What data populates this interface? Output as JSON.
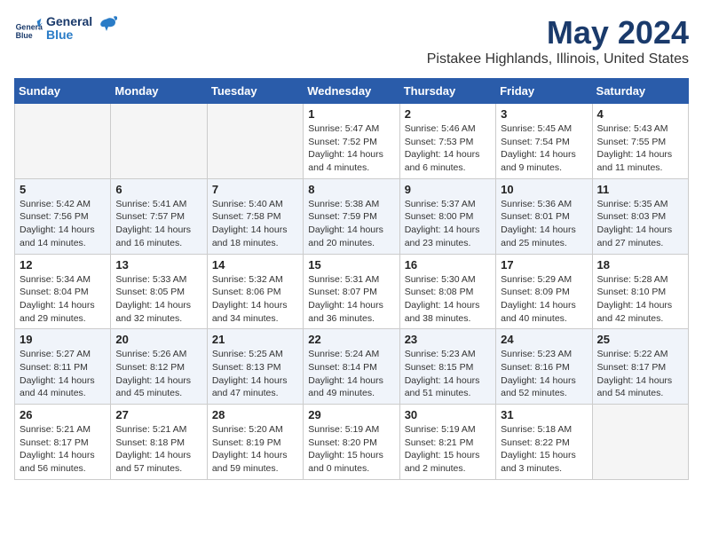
{
  "logo": {
    "line1": "General",
    "line2": "Blue"
  },
  "title": "May 2024",
  "location": "Pistakee Highlands, Illinois, United States",
  "days_of_week": [
    "Sunday",
    "Monday",
    "Tuesday",
    "Wednesday",
    "Thursday",
    "Friday",
    "Saturday"
  ],
  "weeks": [
    [
      {
        "day": "",
        "info": ""
      },
      {
        "day": "",
        "info": ""
      },
      {
        "day": "",
        "info": ""
      },
      {
        "day": "1",
        "info": "Sunrise: 5:47 AM\nSunset: 7:52 PM\nDaylight: 14 hours\nand 4 minutes."
      },
      {
        "day": "2",
        "info": "Sunrise: 5:46 AM\nSunset: 7:53 PM\nDaylight: 14 hours\nand 6 minutes."
      },
      {
        "day": "3",
        "info": "Sunrise: 5:45 AM\nSunset: 7:54 PM\nDaylight: 14 hours\nand 9 minutes."
      },
      {
        "day": "4",
        "info": "Sunrise: 5:43 AM\nSunset: 7:55 PM\nDaylight: 14 hours\nand 11 minutes."
      }
    ],
    [
      {
        "day": "5",
        "info": "Sunrise: 5:42 AM\nSunset: 7:56 PM\nDaylight: 14 hours\nand 14 minutes."
      },
      {
        "day": "6",
        "info": "Sunrise: 5:41 AM\nSunset: 7:57 PM\nDaylight: 14 hours\nand 16 minutes."
      },
      {
        "day": "7",
        "info": "Sunrise: 5:40 AM\nSunset: 7:58 PM\nDaylight: 14 hours\nand 18 minutes."
      },
      {
        "day": "8",
        "info": "Sunrise: 5:38 AM\nSunset: 7:59 PM\nDaylight: 14 hours\nand 20 minutes."
      },
      {
        "day": "9",
        "info": "Sunrise: 5:37 AM\nSunset: 8:00 PM\nDaylight: 14 hours\nand 23 minutes."
      },
      {
        "day": "10",
        "info": "Sunrise: 5:36 AM\nSunset: 8:01 PM\nDaylight: 14 hours\nand 25 minutes."
      },
      {
        "day": "11",
        "info": "Sunrise: 5:35 AM\nSunset: 8:03 PM\nDaylight: 14 hours\nand 27 minutes."
      }
    ],
    [
      {
        "day": "12",
        "info": "Sunrise: 5:34 AM\nSunset: 8:04 PM\nDaylight: 14 hours\nand 29 minutes."
      },
      {
        "day": "13",
        "info": "Sunrise: 5:33 AM\nSunset: 8:05 PM\nDaylight: 14 hours\nand 32 minutes."
      },
      {
        "day": "14",
        "info": "Sunrise: 5:32 AM\nSunset: 8:06 PM\nDaylight: 14 hours\nand 34 minutes."
      },
      {
        "day": "15",
        "info": "Sunrise: 5:31 AM\nSunset: 8:07 PM\nDaylight: 14 hours\nand 36 minutes."
      },
      {
        "day": "16",
        "info": "Sunrise: 5:30 AM\nSunset: 8:08 PM\nDaylight: 14 hours\nand 38 minutes."
      },
      {
        "day": "17",
        "info": "Sunrise: 5:29 AM\nSunset: 8:09 PM\nDaylight: 14 hours\nand 40 minutes."
      },
      {
        "day": "18",
        "info": "Sunrise: 5:28 AM\nSunset: 8:10 PM\nDaylight: 14 hours\nand 42 minutes."
      }
    ],
    [
      {
        "day": "19",
        "info": "Sunrise: 5:27 AM\nSunset: 8:11 PM\nDaylight: 14 hours\nand 44 minutes."
      },
      {
        "day": "20",
        "info": "Sunrise: 5:26 AM\nSunset: 8:12 PM\nDaylight: 14 hours\nand 45 minutes."
      },
      {
        "day": "21",
        "info": "Sunrise: 5:25 AM\nSunset: 8:13 PM\nDaylight: 14 hours\nand 47 minutes."
      },
      {
        "day": "22",
        "info": "Sunrise: 5:24 AM\nSunset: 8:14 PM\nDaylight: 14 hours\nand 49 minutes."
      },
      {
        "day": "23",
        "info": "Sunrise: 5:23 AM\nSunset: 8:15 PM\nDaylight: 14 hours\nand 51 minutes."
      },
      {
        "day": "24",
        "info": "Sunrise: 5:23 AM\nSunset: 8:16 PM\nDaylight: 14 hours\nand 52 minutes."
      },
      {
        "day": "25",
        "info": "Sunrise: 5:22 AM\nSunset: 8:17 PM\nDaylight: 14 hours\nand 54 minutes."
      }
    ],
    [
      {
        "day": "26",
        "info": "Sunrise: 5:21 AM\nSunset: 8:17 PM\nDaylight: 14 hours\nand 56 minutes."
      },
      {
        "day": "27",
        "info": "Sunrise: 5:21 AM\nSunset: 8:18 PM\nDaylight: 14 hours\nand 57 minutes."
      },
      {
        "day": "28",
        "info": "Sunrise: 5:20 AM\nSunset: 8:19 PM\nDaylight: 14 hours\nand 59 minutes."
      },
      {
        "day": "29",
        "info": "Sunrise: 5:19 AM\nSunset: 8:20 PM\nDaylight: 15 hours\nand 0 minutes."
      },
      {
        "day": "30",
        "info": "Sunrise: 5:19 AM\nSunset: 8:21 PM\nDaylight: 15 hours\nand 2 minutes."
      },
      {
        "day": "31",
        "info": "Sunrise: 5:18 AM\nSunset: 8:22 PM\nDaylight: 15 hours\nand 3 minutes."
      },
      {
        "day": "",
        "info": ""
      }
    ]
  ]
}
